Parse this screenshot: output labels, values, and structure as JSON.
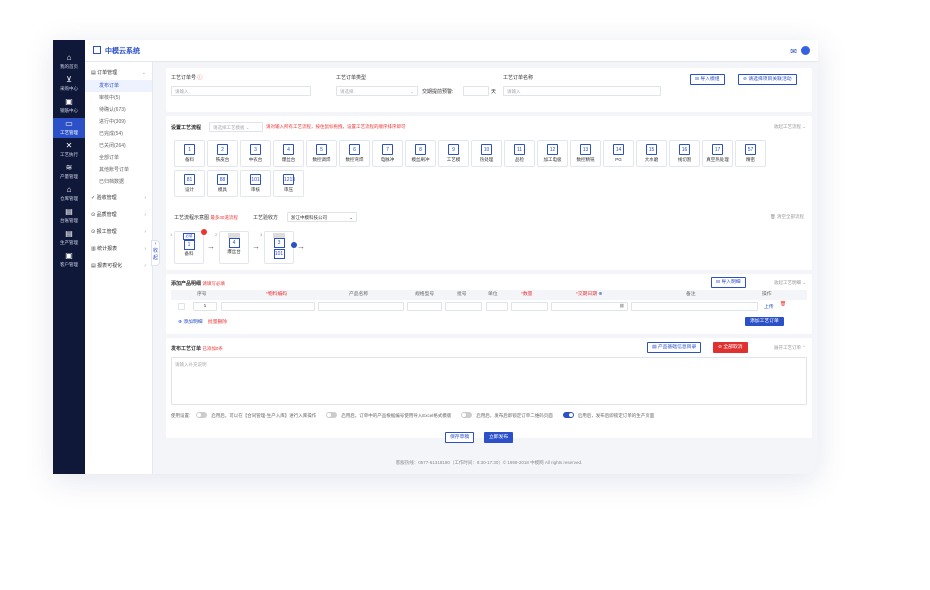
{
  "brand": {
    "title": "中模云系统"
  },
  "rail": [
    {
      "label": "我的首页",
      "icon": "home-icon",
      "glyph": "⌂"
    },
    {
      "label": "采购中心",
      "icon": "cart-icon",
      "glyph": "⊻"
    },
    {
      "label": "钢筋中心",
      "icon": "box-icon",
      "glyph": "▣"
    },
    {
      "label": "工艺管理",
      "icon": "screen-icon",
      "glyph": "▭"
    },
    {
      "label": "工艺执行",
      "icon": "tools-icon",
      "glyph": "✕"
    },
    {
      "label": "产量管理",
      "icon": "layers-icon",
      "glyph": "≋"
    },
    {
      "label": "仓库管理",
      "icon": "warehouse-icon",
      "glyph": "⌂"
    },
    {
      "label": "台账管理",
      "icon": "ledger-icon",
      "glyph": "▤"
    },
    {
      "label": "生产管理",
      "icon": "doc-icon",
      "glyph": "▤"
    },
    {
      "label": "客户管理",
      "icon": "customer-icon",
      "glyph": "▣"
    }
  ],
  "submenu": {
    "group1": "订单管理",
    "items": [
      "发布订单",
      "审核中(5)",
      "待确认(673)",
      "进行中(309)",
      "已完成(54)",
      "已关闭(264)",
      "全部订单",
      "其他账号订单",
      "已归档数据"
    ],
    "groups": [
      "验收管理",
      "品质管理",
      "报工管理",
      "统计报表",
      "报表可视化"
    ],
    "collapse": "收起"
  },
  "order": {
    "no_label": "工艺订单号",
    "no_placeholder": "请输入",
    "type_label": "工艺订单类型",
    "type_placeholder": "请选择",
    "delivery_label": "交期提前预警:",
    "delivery_unit": "天",
    "name_label": "工艺订单名称",
    "name_placeholder": "请输入",
    "import_btn": "导入模组",
    "link_btn": "请选择项目关联活动"
  },
  "process": {
    "title": "设置工艺流程",
    "select_placeholder": "请选择工艺模板",
    "hint": "请对输入所有工艺流程，按住鼠标拖拽，设置工艺流程的顺序排序即可",
    "collapse": "收起工艺流程",
    "items": [
      {
        "n": "1",
        "t": "备料"
      },
      {
        "n": "2",
        "t": "铁皮台"
      },
      {
        "n": "3",
        "t": "中农台"
      },
      {
        "n": "4",
        "t": "爆丝台"
      },
      {
        "n": "5",
        "t": "数控调焊"
      },
      {
        "n": "6",
        "t": "数控弯焊"
      },
      {
        "n": "7",
        "t": "电脉冲"
      },
      {
        "n": "8",
        "t": "模丝刷冲"
      },
      {
        "n": "9",
        "t": "工艺模"
      },
      {
        "n": "10",
        "t": "热处理"
      },
      {
        "n": "11",
        "t": "品检"
      },
      {
        "n": "12",
        "t": "加工电极"
      },
      {
        "n": "13",
        "t": "数控精铣"
      },
      {
        "n": "14",
        "t": "PG"
      },
      {
        "n": "15",
        "t": "大水磨"
      },
      {
        "n": "16",
        "t": "线切割"
      },
      {
        "n": "17",
        "t": "真空热处理"
      },
      {
        "n": "57",
        "t": "精密"
      },
      {
        "n": "81",
        "t": "设计"
      },
      {
        "n": "88",
        "t": "模具"
      },
      {
        "n": "101",
        "t": "审核"
      },
      {
        "n": "1213",
        "t": "审压"
      }
    ],
    "flow_label": "工艺流程示意图",
    "flow_hint": "最多30道流程",
    "receiver_label": "工艺验收方",
    "receiver_value": "浙江中模科技公司",
    "clear_label": "清空全部流程",
    "flow": [
      {
        "idx": "1",
        "tag": "必填",
        "n": "1",
        "t": "备料"
      },
      {
        "idx": "2",
        "tag": "",
        "n": "4",
        "t": "爆丝台"
      },
      {
        "idx": "3",
        "tag": "",
        "n": "3",
        "t": "",
        "n2": "101"
      }
    ]
  },
  "products": {
    "title": "添加产品明细",
    "hint": "请填写必填",
    "import_btn": "导入明细",
    "collapse": "收起工艺明细",
    "headers": [
      "序号",
      "*物料编码",
      "产品名称",
      "规格型号",
      "批号",
      "单位",
      "*数量",
      "*交期日期",
      "备注",
      "操作"
    ],
    "row_index": "1",
    "upload": "上传",
    "add_row": "添加明细",
    "batch_delete": "批量删除",
    "add_process_btn": "添加工艺订单"
  },
  "publish": {
    "title": "发布工艺订单",
    "hint": "已添加0条",
    "archive_btn": "产品基础信息目录",
    "clear_btn": "全部取消",
    "collapse": "展开工艺订单",
    "placeholder": "请输入补充说明"
  },
  "settings": {
    "label": "使用设置:",
    "opts": [
      {
        "text": "启用后，可以在【合同管理-生产入库】进行入库操作",
        "on": false
      },
      {
        "text": "启用后，订单中的产品根据编号使用导入Excel格式模版",
        "on": false
      },
      {
        "text": "启用后，发布后即锁定订单二维码页面",
        "on": false
      },
      {
        "text": "启用后，发布后即锁定订单的生产页面",
        "on": true
      }
    ]
  },
  "actions": {
    "save": "保存草稿",
    "submit": "立即发布"
  },
  "footer": "客服热线：0577-61318180（工作时间：8:30-17:30）© 1999-2018 中模网 All rights reserved."
}
